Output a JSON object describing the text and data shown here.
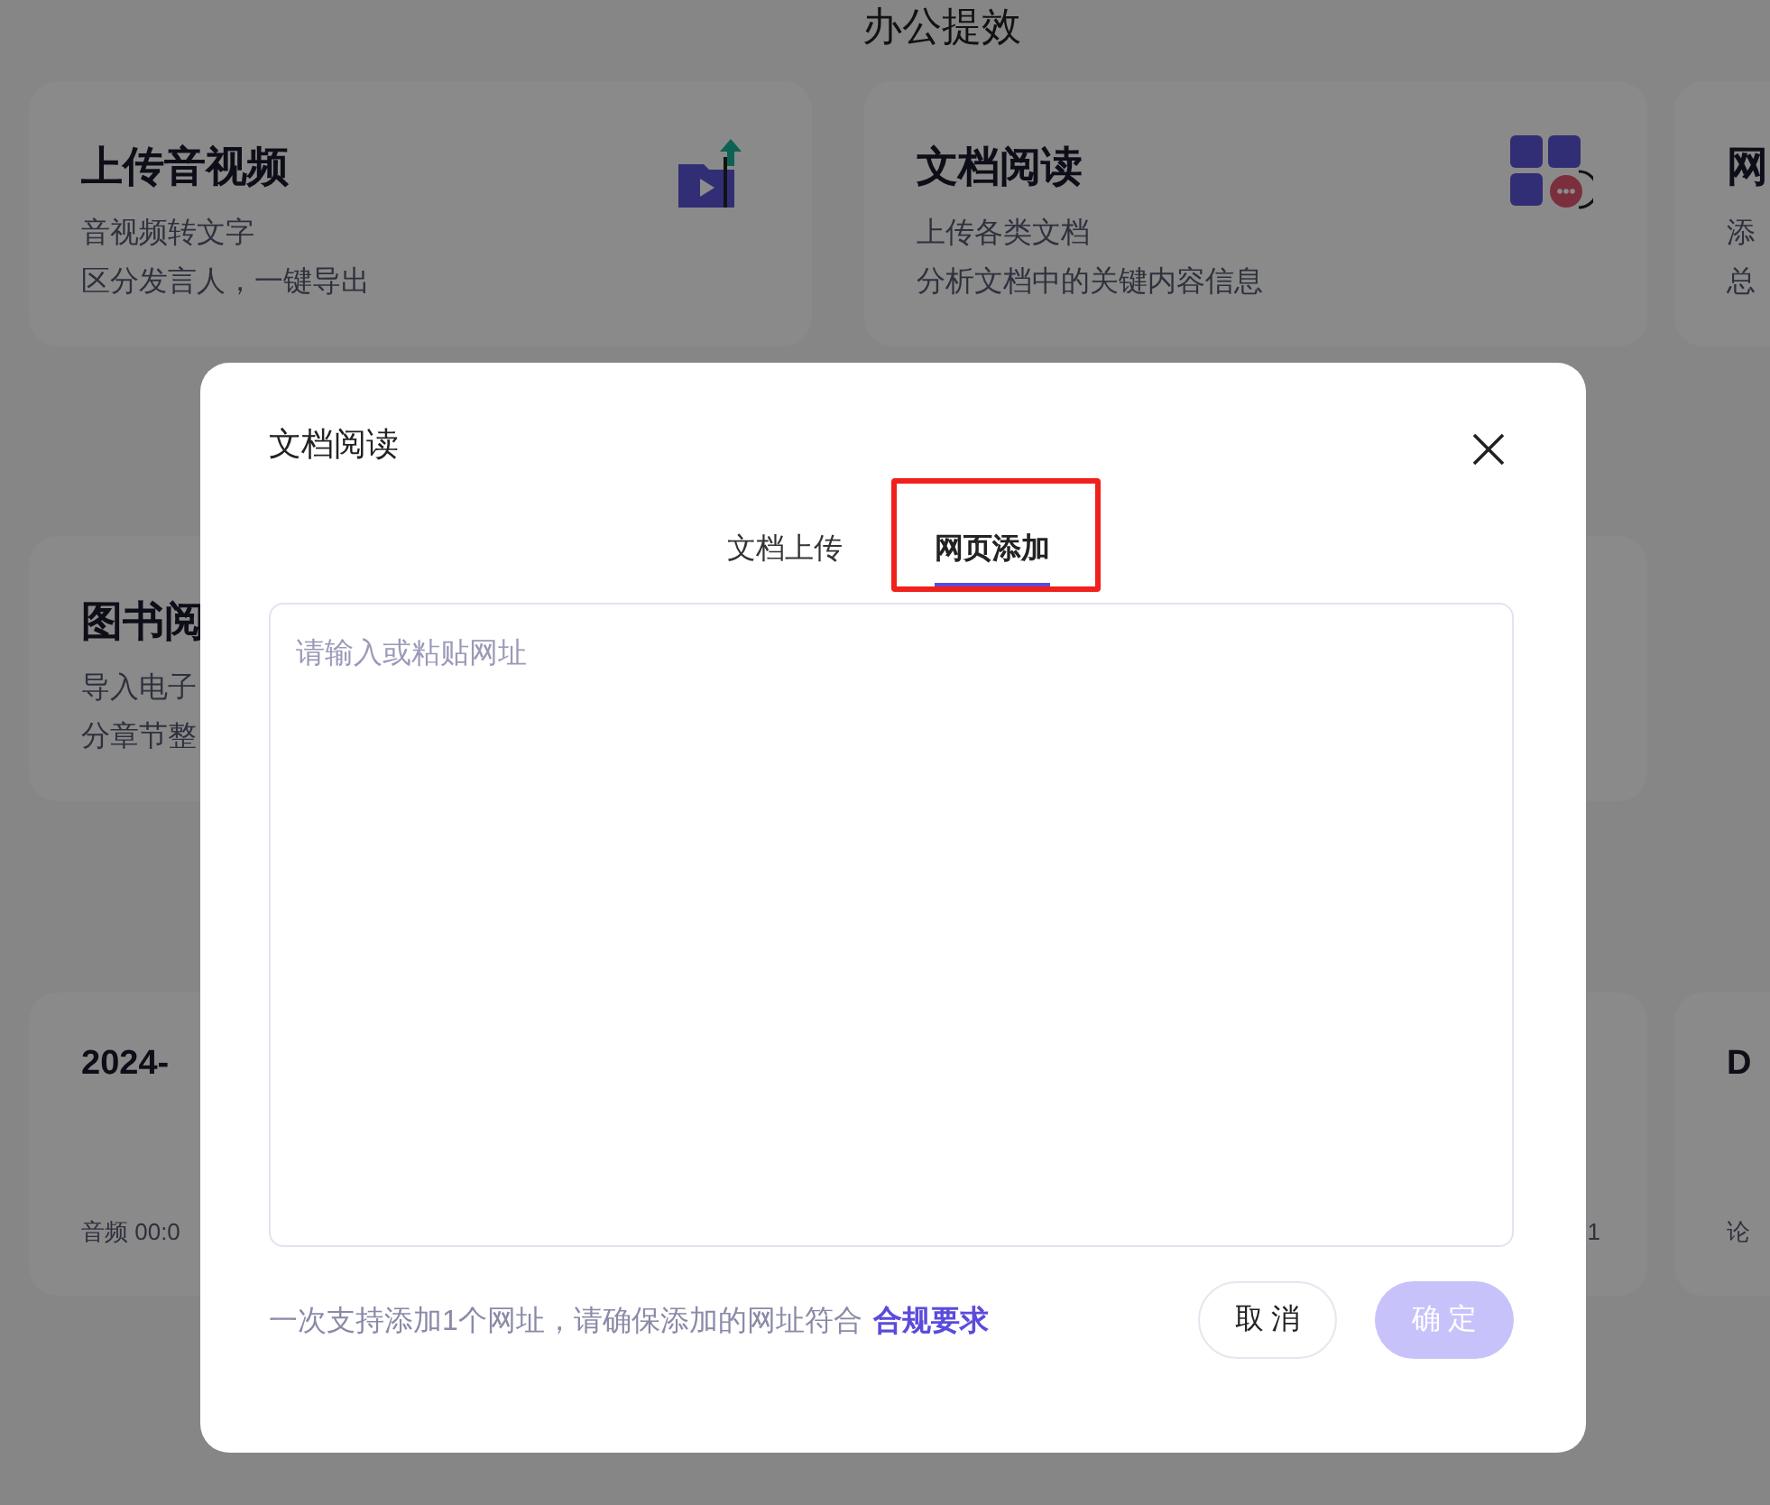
{
  "page": {
    "title": "办公提效",
    "cards": [
      {
        "kind": "feature",
        "title": "上传音视频",
        "lines": [
          "音视频转文字",
          "区分发言人，一键导出"
        ]
      },
      {
        "kind": "feature",
        "title": "文档阅读",
        "lines": [
          "上传各类文档",
          "分析文档中的关键内容信息"
        ]
      },
      {
        "kind": "feature",
        "title": "网",
        "lines": [
          "添",
          "总"
        ]
      },
      {
        "kind": "feature",
        "title": "图书阅",
        "lines": [
          "导入电子",
          "分章节整"
        ]
      },
      {
        "kind": "blank"
      },
      {
        "kind": "record",
        "title": "2024-",
        "meta": "音频 00:0"
      },
      {
        "kind": "record",
        "meta_end": "1"
      },
      {
        "kind": "record",
        "title": "D",
        "meta": "论"
      }
    ]
  },
  "dialog": {
    "title": "文档阅读",
    "tabs": [
      {
        "label": "文档上传",
        "selected": false
      },
      {
        "label": "网页添加",
        "selected": true,
        "highlighted": true
      }
    ],
    "url_field": {
      "placeholder": "请输入或粘贴网址"
    },
    "note": "一次支持添加1个网址，请确保添加的网址符合",
    "note_link": "合规要求",
    "buttons": [
      {
        "label": "取 消",
        "kind": "secondary",
        "disabled": false
      },
      {
        "label": "确 定",
        "kind": "primary",
        "disabled": true
      }
    ]
  }
}
